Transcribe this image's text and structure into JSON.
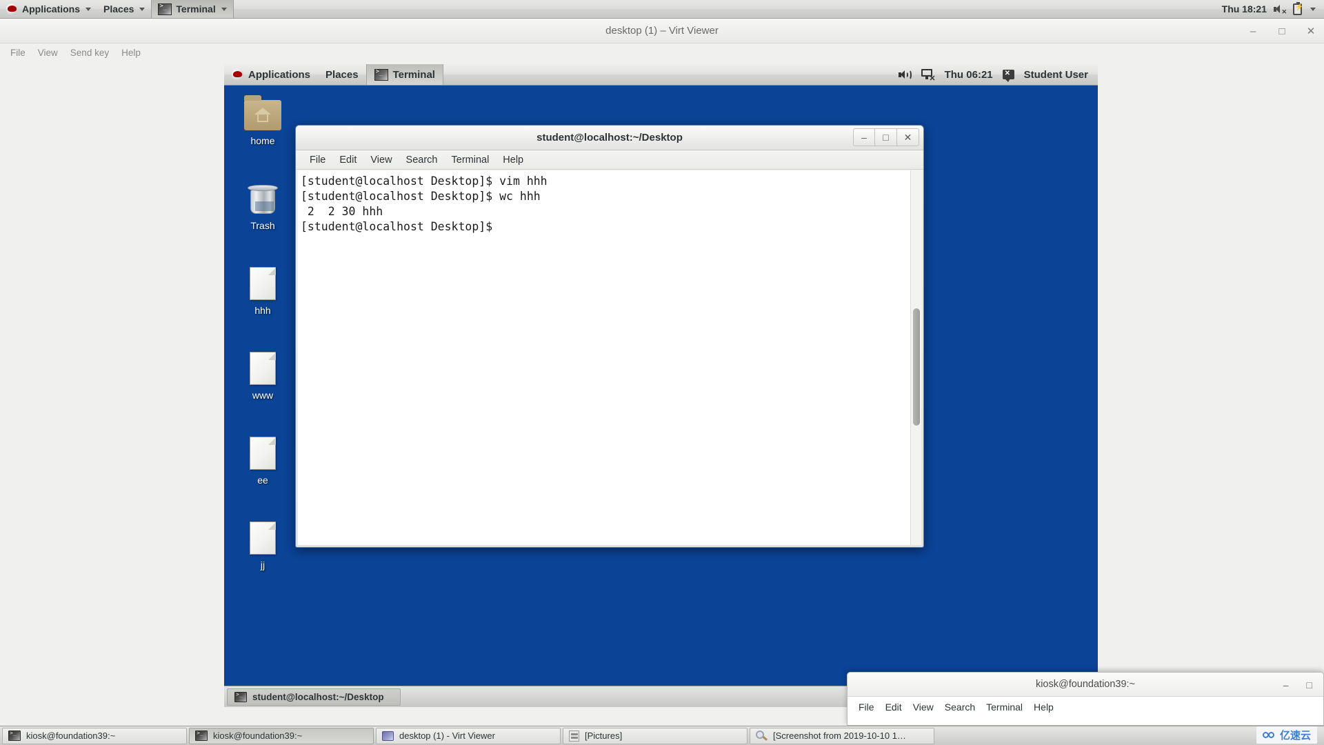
{
  "host_panel": {
    "logo": "redhat-logo",
    "menus": [
      {
        "label": "Applications",
        "has_caret": true
      },
      {
        "label": "Places",
        "has_caret": true
      }
    ],
    "active_task": {
      "label": "Terminal",
      "has_caret": true,
      "icon": "terminal-icon"
    },
    "clock": "Thu 18:21",
    "tray_icons": [
      "speaker-muted-icon",
      "battery-charging-icon",
      "chevron-down-icon"
    ]
  },
  "virt_viewer": {
    "title": "desktop (1) – Virt Viewer",
    "menus": [
      "File",
      "View",
      "Send key",
      "Help"
    ],
    "window_buttons": {
      "minimize": "–",
      "maximize": "□",
      "close": "✕"
    }
  },
  "guest_panel": {
    "logo": "redhat-logo",
    "menus": [
      {
        "label": "Applications"
      },
      {
        "label": "Places"
      }
    ],
    "active_task": {
      "label": "Terminal",
      "icon": "terminal-icon"
    },
    "clock": "Thu 06:21",
    "user": "Student User",
    "tray_icons": [
      "volume-icon",
      "network-disconnected-icon",
      "chat-icon"
    ]
  },
  "desktop_icons": [
    {
      "label": "home",
      "type": "folder-home-icon"
    },
    {
      "label": "Trash",
      "type": "trash-icon"
    },
    {
      "label": "hhh",
      "type": "file-icon"
    },
    {
      "label": "www",
      "type": "file-icon"
    },
    {
      "label": "ee",
      "type": "file-icon"
    },
    {
      "label": "jj",
      "type": "file-icon"
    }
  ],
  "guest_terminal": {
    "title": "student@localhost:~/Desktop",
    "menus": [
      "File",
      "Edit",
      "View",
      "Search",
      "Terminal",
      "Help"
    ],
    "window_buttons": {
      "minimize": "–",
      "maximize": "□",
      "close": "✕"
    },
    "lines": [
      "[student@localhost Desktop]$ vim hhh",
      "[student@localhost Desktop]$ wc hhh",
      " 2  2 30 hhh",
      "[student@localhost Desktop]$"
    ],
    "content": "[student@localhost Desktop]$ vim hhh\n[student@localhost Desktop]$ wc hhh\n 2  2 30 hhh\n[student@localhost Desktop]$"
  },
  "guest_taskbar": {
    "tasks": [
      {
        "label": "student@localhost:~/Desktop",
        "icon": "terminal-icon",
        "active": true
      }
    ]
  },
  "background_terminal": {
    "title": "kiosk@foundation39:~",
    "menus": [
      "File",
      "Edit",
      "View",
      "Search",
      "Terminal",
      "Help"
    ],
    "window_buttons": {
      "minimize": "–",
      "maximize": "□"
    }
  },
  "host_taskbar": {
    "tasks": [
      {
        "label": "kiosk@foundation39:~",
        "icon": "terminal-icon",
        "pressed": false
      },
      {
        "label": "kiosk@foundation39:~",
        "icon": "terminal-icon",
        "pressed": true
      },
      {
        "label": "desktop (1) - Virt Viewer",
        "icon": "monitor-icon",
        "pressed": false
      },
      {
        "label": "[Pictures]",
        "icon": "pictures-icon",
        "pressed": false
      },
      {
        "label": "[Screenshot from 2019-10-10 1…",
        "icon": "image-viewer-icon",
        "pressed": false
      }
    ],
    "watermark": "亿速云"
  },
  "colors": {
    "desktop_blue": "#0b4396",
    "panel_grey": "#d6d6d4",
    "terminal_bg": "#ffffff",
    "terminal_fg": "#1b1b1b"
  }
}
